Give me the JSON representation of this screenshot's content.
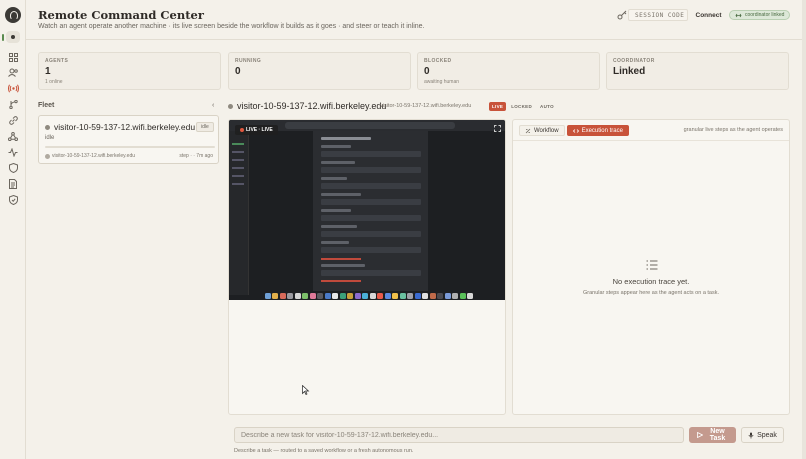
{
  "header": {
    "title": "Remote Command Center",
    "subtitle": "Watch an agent operate another machine · its live screen beside the workflow it builds as it goes · and steer or teach it inline.",
    "session_code_placeholder": "SESSION CODE",
    "connect_label": "Connect",
    "coordinator_badge": "coordinator linked"
  },
  "nav": {
    "items": [
      "home-icon",
      "grid-icon",
      "users-icon",
      "broadcast-icon",
      "branch-icon",
      "link-icon",
      "network-icon",
      "activity-icon",
      "shield-icon",
      "document-icon",
      "lock-icon"
    ],
    "active": "broadcast-icon"
  },
  "stats": [
    {
      "label": "AGENTS",
      "value": "1",
      "sub": "1 online"
    },
    {
      "label": "RUNNING",
      "value": "0",
      "sub": ""
    },
    {
      "label": "BLOCKED",
      "value": "0",
      "sub": "awaiting human"
    },
    {
      "label": "COORDINATOR",
      "value": "Linked",
      "sub": ""
    }
  ],
  "fleet": {
    "label": "Fleet",
    "collapse_glyph": "‹",
    "agent": {
      "name": "visitor-10-59-137-12.wifi.berkeley.edu",
      "status_badge": "idle",
      "state": "idle",
      "host": "visitor-10-59-137-12.wifi.berkeley.edu",
      "time": "step · · 7m ago"
    }
  },
  "focus": {
    "name": "visitor-10-59-137-12.wifi.berkeley.edu",
    "host": "visitor-10-59-137-12.wifi.berkeley.edu",
    "modes": [
      "LIVE",
      "LOCKED",
      "AUTO"
    ],
    "active_mode": "LIVE",
    "live_badge": "LIVE · LIVE"
  },
  "trace": {
    "tabs": [
      "Workflow",
      "Execution trace"
    ],
    "active_tab": "Execution trace",
    "hint": "granular live steps as the agent operates",
    "empty_title": "No execution trace yet.",
    "empty_sub": "Granular steps appear here as the agent acts on a task."
  },
  "composer": {
    "placeholder": "Describe a new task for visitor-10-59-137-12.wifi.berkeley.edu...",
    "new_task_label": "New Task",
    "speak_label": "Speak",
    "hint": "Describe a task — routed to a saved workflow or a fresh autonomous run."
  },
  "colors": {
    "accent": "#c8533a",
    "background": "#f4f1ea",
    "linked_green": "#4a6b42"
  }
}
